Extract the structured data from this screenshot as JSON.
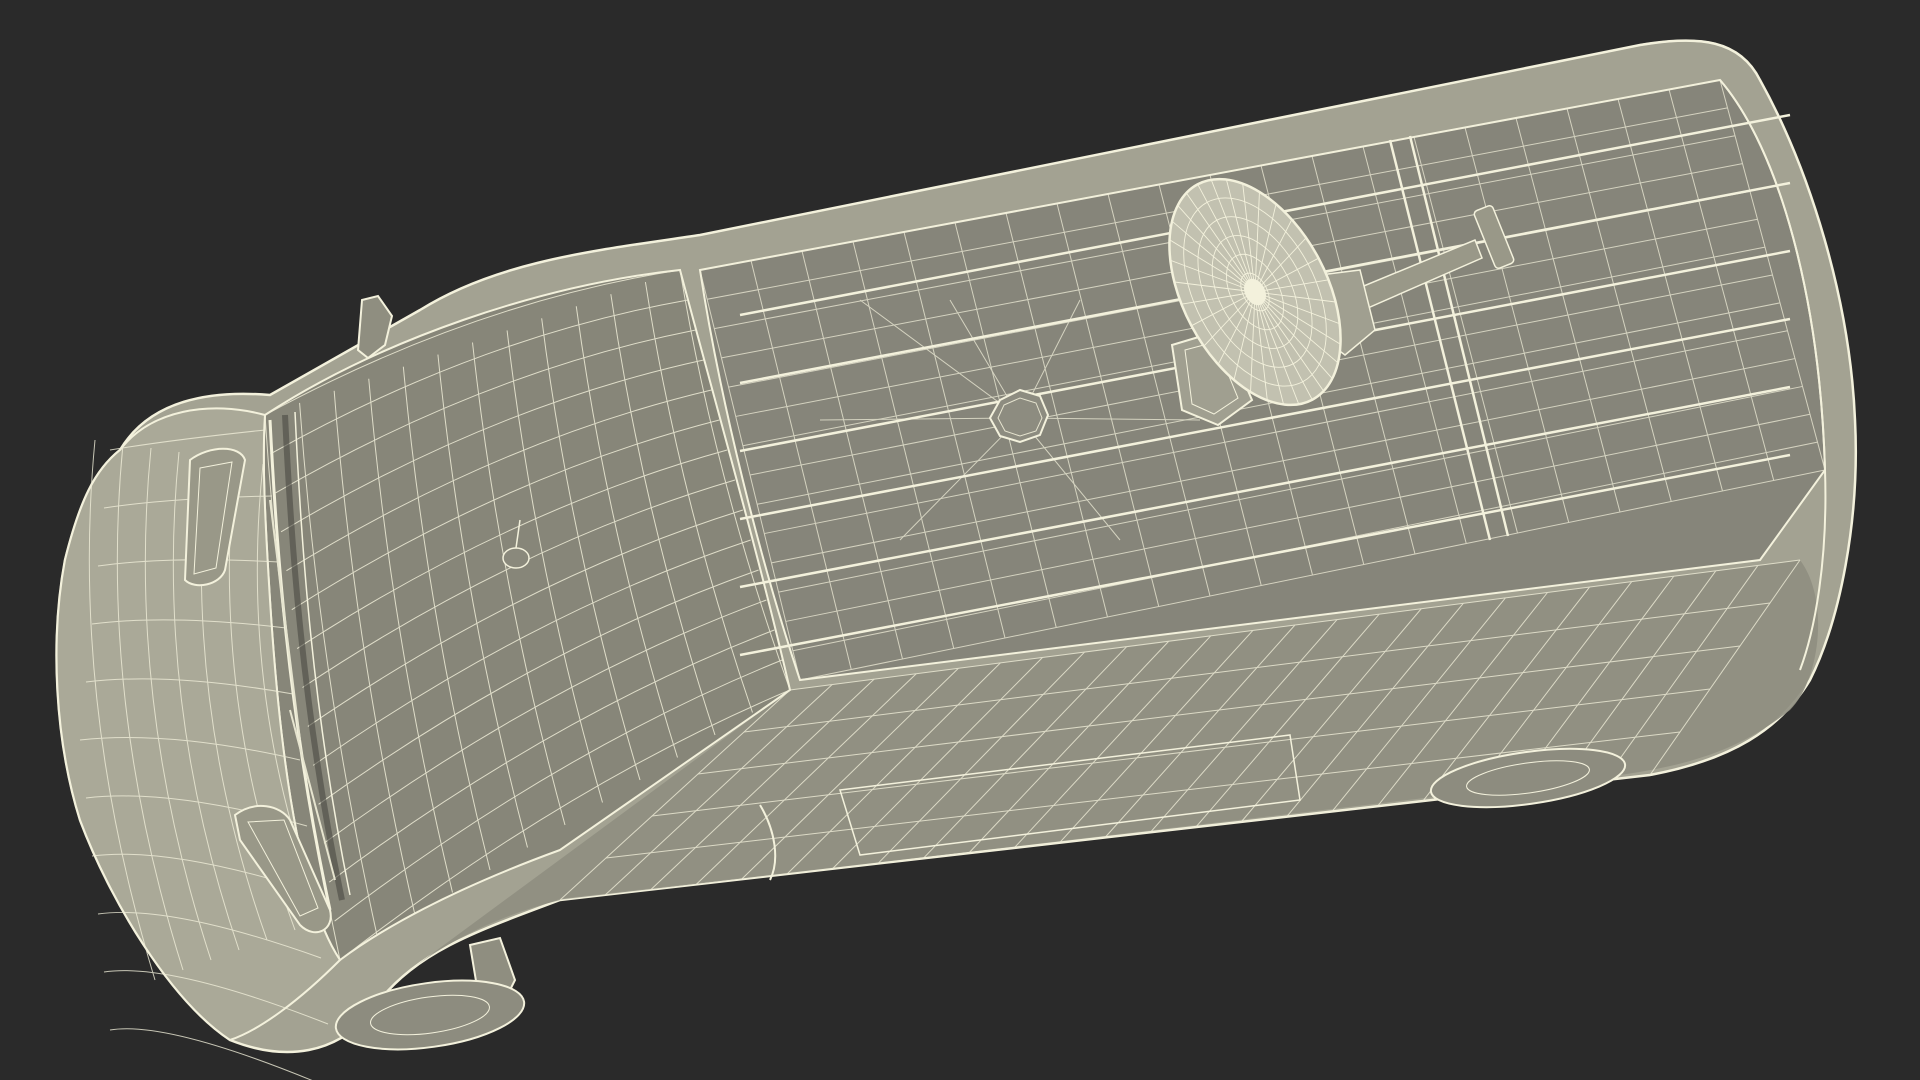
{
  "scene": {
    "subject": "van-wireframe-render",
    "render_style": "wireframe-on-shaded",
    "colors": {
      "background": "#2a2a2a",
      "body_fill": "#a3a292",
      "body_shadow": "#7d7c6f",
      "roof_fill": "#8a897c",
      "wire": "#f3f1dc",
      "wire_dim": "#d8d6c2",
      "dark_detail": "#5a5950"
    },
    "parts": [
      "body",
      "roof",
      "hood",
      "windshield",
      "roof-rails",
      "satellite-dish",
      "side-mirror-left",
      "side-mirror-right",
      "headlight-left",
      "headlight-right",
      "front-wheel",
      "rear-wheel",
      "sliding-door"
    ]
  }
}
